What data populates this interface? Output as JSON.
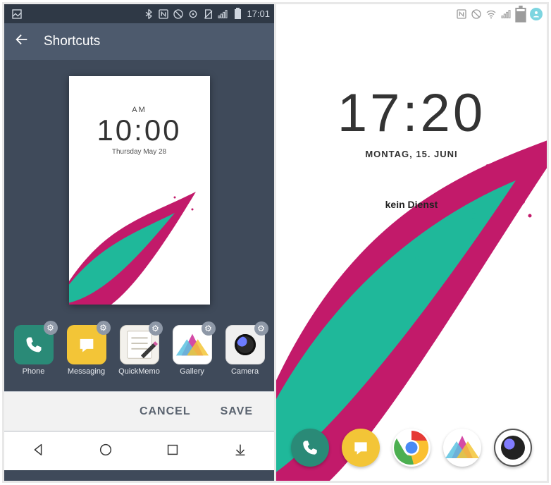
{
  "left": {
    "status": {
      "time": "17:01"
    },
    "header": {
      "title": "Shortcuts"
    },
    "preview": {
      "ampm": "AM",
      "time": "10:00",
      "date": "Thursday May 28"
    },
    "shortcuts": [
      {
        "label": "Phone"
      },
      {
        "label": "Messaging"
      },
      {
        "label": "QuickMemo"
      },
      {
        "label": "Gallery"
      },
      {
        "label": "Camera"
      }
    ],
    "actions": {
      "cancel": "CANCEL",
      "save": "SAVE"
    }
  },
  "right": {
    "lock": {
      "time": "17:20",
      "date": "MONTAG, 15. JUNI",
      "carrier": "kein Dienst"
    }
  }
}
